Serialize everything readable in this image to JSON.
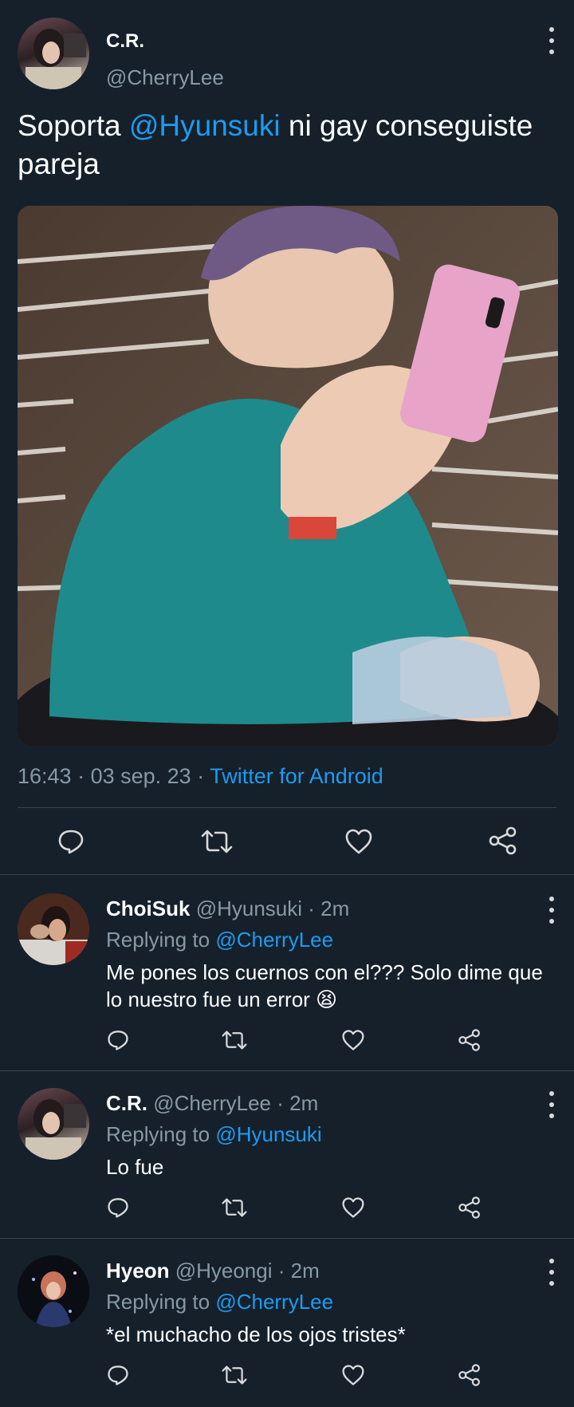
{
  "main_tweet": {
    "display_name": "C.R.",
    "handle": "@CherryLee",
    "text_prefix": "Soporta ",
    "mention": "@Hyunsuki",
    "text_suffix": " ni gay conseguiste pareja",
    "time": "16:43",
    "sep1": " · ",
    "date": "03 sep. 23",
    "sep2": " · ",
    "client": "Twitter for Android",
    "actions": [
      "reply-icon",
      "retweet-icon",
      "like-icon",
      "share-icon"
    ]
  },
  "replies": [
    {
      "display_name": "ChoiSuk",
      "handle": "@Hyunsuki",
      "time": " · 2m",
      "replying_label": "Replying to ",
      "replying_to": "@CherryLee",
      "text": "Me pones los cuernos con el??? Solo dime que lo nuestro fue un error 😫"
    },
    {
      "display_name": "C.R.",
      "handle": "@CherryLee",
      "time": " · 2m",
      "replying_label": "Replying to ",
      "replying_to": "@Hyunsuki",
      "text": "Lo fue"
    },
    {
      "display_name": "Hyeon",
      "handle": "@Hyeongi",
      "time": " · 2m",
      "replying_label": "Replying to ",
      "replying_to": "@CherryLee",
      "text": "*el muchacho de los ojos tristes*"
    }
  ],
  "colors": {
    "background": "#15202b",
    "link": "#1d9bf0",
    "muted": "#8899a6",
    "divider": "#38444d"
  }
}
